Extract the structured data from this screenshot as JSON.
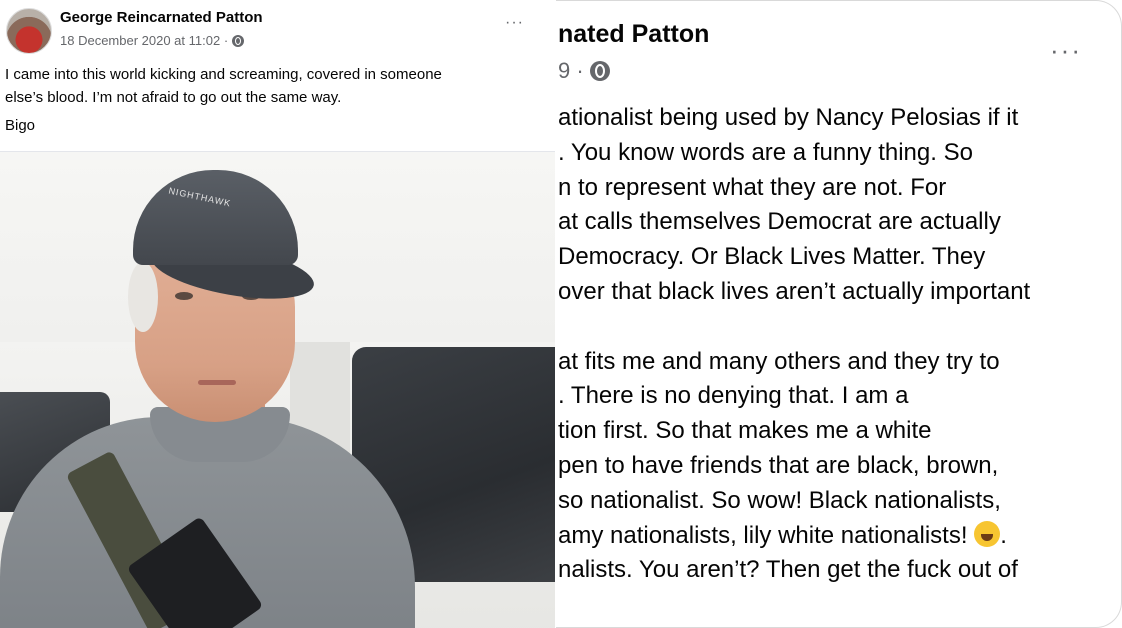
{
  "left_post": {
    "author": "George Reincarnated Patton",
    "timestamp": "18 December 2020 at 11:02 ·",
    "audience_icon": "globe-icon",
    "more_icon": "···",
    "text_line_1": "I came into this world kicking and screaming, covered in someone",
    "text_line_2": "else’s blood.  I’m not afraid to go out the same way.",
    "signature": "Bigo",
    "photo_cap_text": "NIGHTHAWK"
  },
  "right_crop": {
    "author_fragment": "nated Patton",
    "meta_fragment": "9 ·",
    "audience_icon": "globe-icon",
    "more_icon": "···",
    "lines": [
      "ationalist being used by Nancy Pelosias if it",
      ".  You know words are a funny thing.  So",
      "n to represent what they are not.  For",
      "at calls themselves Democrat are actually",
      "Democracy.  Or Black Lives Matter.  They",
      "over that black lives aren’t actually important",
      "",
      "at fits me and many others and they try to",
      ".  There is no denying that.  I am a",
      "tion first.  So that makes me a white",
      "pen to have friends that are black, brown,",
      "so nationalist.  So wow! Black nationalists,",
      "amy nationalists, lily white nationalists!",
      "nalists.  You aren’t?  Then get the fuck out of"
    ],
    "emoji_after_line_13": "laughing-crying-emoji",
    "emoji_trailing": "."
  }
}
